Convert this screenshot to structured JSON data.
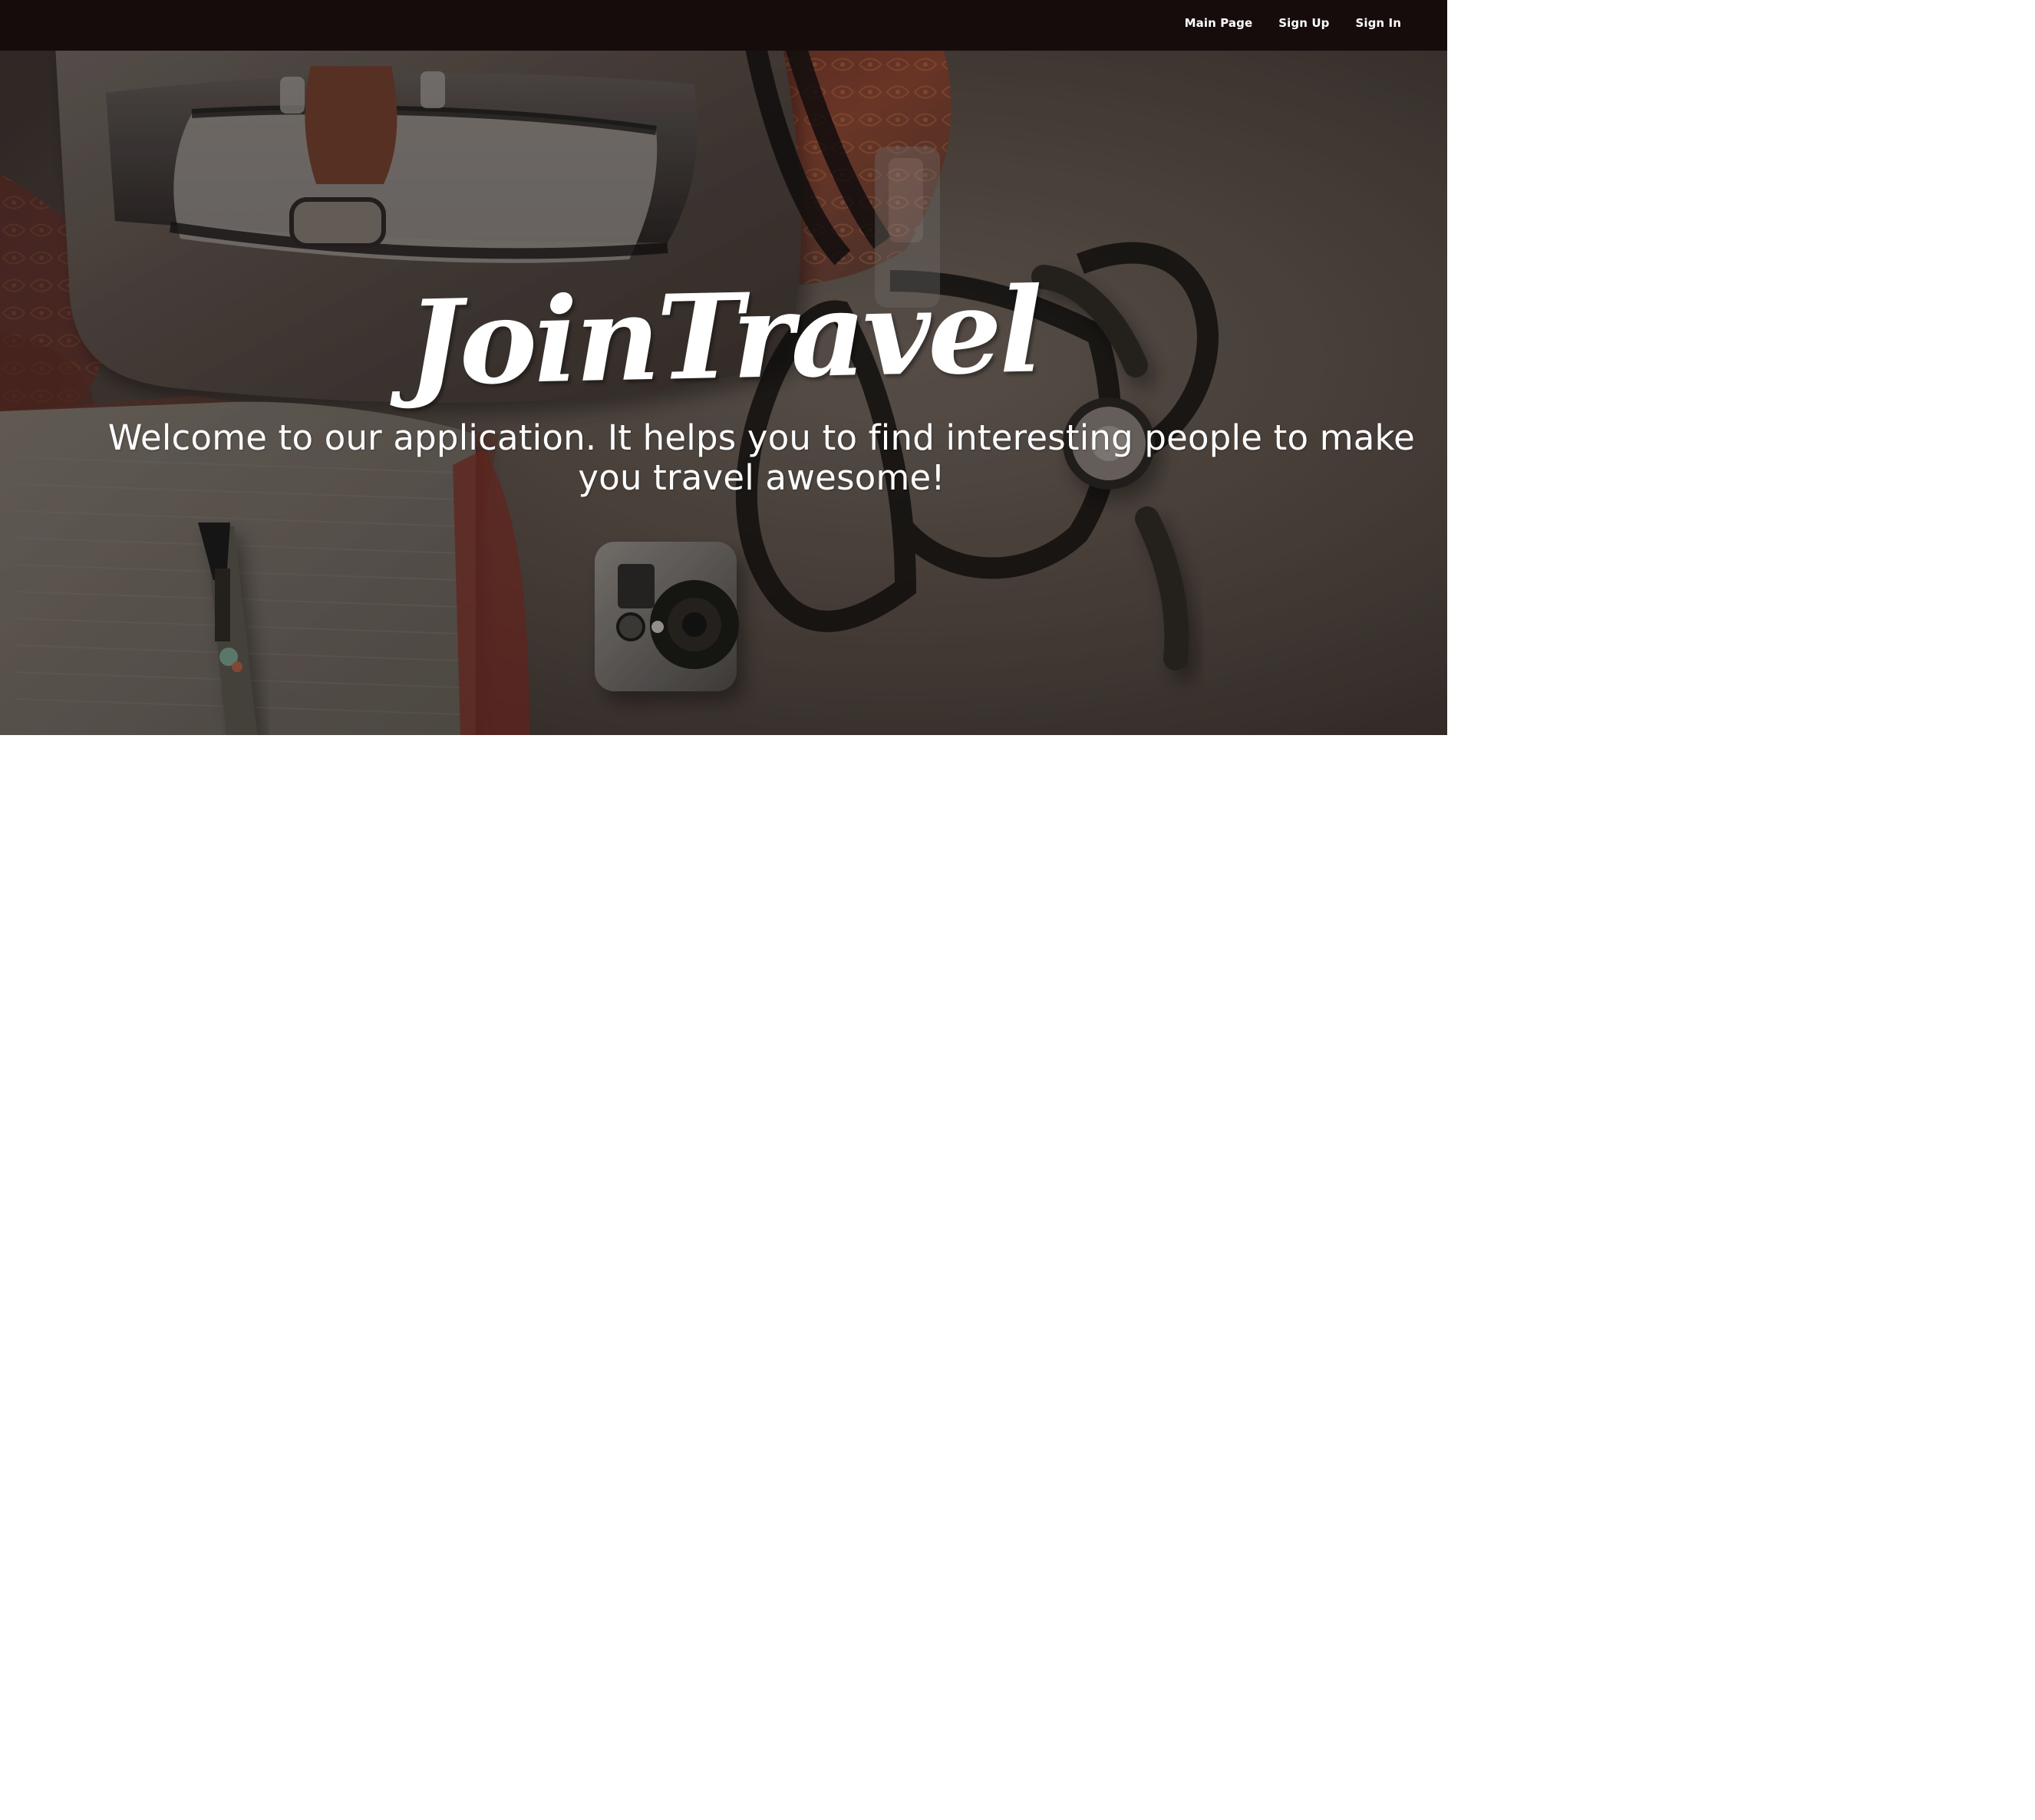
{
  "navbar": {
    "links": [
      {
        "label": "Main Page"
      },
      {
        "label": "Sign Up"
      },
      {
        "label": "Sign In"
      }
    ]
  },
  "hero": {
    "title": "JoinTravel",
    "subtitle": "Welcome to our application. It helps you to find interesting people to make you travel awesome!"
  },
  "colors": {
    "navbar_background": "#170c0c",
    "text": "#ffffff",
    "page_background": "#ffffff"
  },
  "icons": {
    "decorative_photo": "travel-flatlay-icon"
  }
}
